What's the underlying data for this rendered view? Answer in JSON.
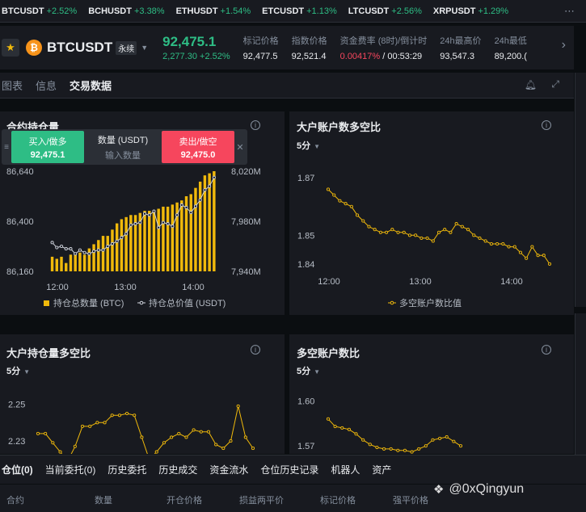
{
  "tickers": [
    {
      "symbol": "BTCUSDT",
      "change": "+2.52%"
    },
    {
      "symbol": "BCHUSDT",
      "change": "+3.38%"
    },
    {
      "symbol": "ETHUSDT",
      "change": "+1.54%"
    },
    {
      "symbol": "ETCUSDT",
      "change": "+1.13%"
    },
    {
      "symbol": "LTCUSDT",
      "change": "+2.56%"
    },
    {
      "symbol": "XRPUSDT",
      "change": "+1.29%"
    }
  ],
  "header": {
    "coin_glyph": "₿",
    "symbol": "BTCUSDT",
    "badge": "永续",
    "price": "92,475.1",
    "change": "2,277.30 +2.52%",
    "stats": [
      {
        "label": "标记价格",
        "value": "92,477.5"
      },
      {
        "label": "指数价格",
        "value": "92,521.4"
      },
      {
        "label": "资金费率 (8时)/倒计时",
        "value_neg": "0.00417%",
        "value": " / 00:53:29"
      },
      {
        "label": "24h最高价",
        "value": "93,547.3"
      },
      {
        "label": "24h最低",
        "value": "89,200.("
      }
    ]
  },
  "tabs": [
    "图表",
    "信息",
    "交易数据"
  ],
  "popup": {
    "buy_label": "买入/做多",
    "buy_price": "92,475.1",
    "qty_label": "数量 (USDT)",
    "qty_placeholder": "输入数量",
    "sell_label": "卖出/做空",
    "sell_price": "92,475.0"
  },
  "panels": {
    "oi": {
      "title": "合约持仓量",
      "y_left_ticks": [
        "86,640",
        "86,400",
        "86,160"
      ],
      "y_right_ticks": [
        "8,020M",
        "7,980M",
        "7,940M"
      ],
      "x_ticks": [
        "12:00",
        "13:00",
        "14:00"
      ],
      "legend_bar": "持仓总数量 (BTC)",
      "legend_line": "持仓总价值 (USDT)"
    },
    "top_accounts": {
      "title": "大户账户数多空比",
      "period": "5分",
      "y_ticks": [
        "1.87",
        "1.85",
        "1.84"
      ],
      "x_ticks": [
        "12:00",
        "13:00",
        "14:00"
      ],
      "legend": "多空账户数比值"
    },
    "top_positions": {
      "title": "大户持仓量多空比",
      "period": "5分",
      "y_ticks": [
        "2.25",
        "2.23"
      ]
    },
    "ls_accounts": {
      "title": "多空账户数比",
      "period": "5分",
      "y_ticks": [
        "1.60",
        "1.57"
      ]
    }
  },
  "bottom_tabs": [
    "仓位(0)",
    "当前委托(0)",
    "历史委托",
    "历史成交",
    "资金流水",
    "仓位历史记录",
    "机器人",
    "资产"
  ],
  "table_headers": [
    "合约",
    "数量",
    "开仓价格",
    "损益两平价",
    "标记价格",
    "强平价格"
  ],
  "watermark": "@0xQingyun",
  "colors": {
    "up": "#2ebd85",
    "down": "#f6465d",
    "accent": "#f0b90b"
  },
  "chart_data": [
    {
      "type": "bar",
      "title": "合约持仓量",
      "xlabel": "",
      "ylabel": "",
      "series": [
        {
          "name": "持仓总数量 (BTC)",
          "type": "bar",
          "axis": "left",
          "values": [
            86230,
            86220,
            86230,
            86200,
            86240,
            86250,
            86250,
            86240,
            86270,
            86290,
            86310,
            86330,
            86330,
            86360,
            86390,
            86410,
            86420,
            86430,
            86430,
            86440,
            86450,
            86450,
            86450,
            86460,
            86470,
            86470,
            86480,
            86490,
            86500,
            86520,
            86530,
            86560,
            86590,
            86620,
            86630,
            86640
          ]
        },
        {
          "name": "持仓总价值 (USDT)",
          "type": "line",
          "axis": "right",
          "values": [
            7963,
            7959,
            7960,
            7958,
            7958,
            7954,
            7957,
            7955,
            7954,
            7956,
            7957,
            7957,
            7960,
            7962,
            7964,
            7967,
            7970,
            7977,
            7978,
            7979,
            7986,
            7985,
            7988,
            7975,
            7979,
            7978,
            7976,
            7985,
            7993,
            7991,
            7987,
            7992,
            7997,
            8005,
            8008,
            8015
          ]
        }
      ],
      "y_left_lim": [
        86160,
        86640
      ],
      "y_right_lim": [
        7940,
        8020
      ]
    },
    {
      "type": "line",
      "title": "大户账户数多空比",
      "series": [
        {
          "name": "多空账户数比值",
          "values": [
            1.866,
            1.864,
            1.862,
            1.861,
            1.86,
            1.857,
            1.855,
            1.853,
            1.852,
            1.851,
            1.851,
            1.852,
            1.851,
            1.851,
            1.85,
            1.85,
            1.849,
            1.849,
            1.848,
            1.851,
            1.852,
            1.851,
            1.854,
            1.853,
            1.852,
            1.85,
            1.849,
            1.848,
            1.847,
            1.847,
            1.847,
            1.846,
            1.846,
            1.844,
            1.842,
            1.846,
            1.843,
            1.843,
            1.84
          ]
        }
      ],
      "ylim": [
        1.838,
        1.874
      ]
    },
    {
      "type": "line",
      "title": "大户持仓量多空比",
      "series": [
        {
          "name": "",
          "values": [
            2.234,
            2.234,
            2.229,
            2.224,
            2.219,
            2.227,
            2.238,
            2.238,
            2.24,
            2.24,
            2.244,
            2.244,
            2.245,
            2.244,
            2.232,
            2.22,
            2.224,
            2.229,
            2.232,
            2.234,
            2.232,
            2.236,
            2.235,
            2.235,
            2.228,
            2.226,
            2.23,
            2.249,
            2.232,
            2.226
          ]
        }
      ],
      "ylim": [
        2.215,
        2.26
      ]
    },
    {
      "type": "line",
      "title": "多空账户数比",
      "series": [
        {
          "name": "",
          "values": [
            1.588,
            1.583,
            1.582,
            1.581,
            1.578,
            1.574,
            1.571,
            1.569,
            1.568,
            1.568,
            1.567,
            1.567,
            1.566,
            1.568,
            1.57,
            1.574,
            1.575,
            1.576,
            1.573,
            1.57
          ]
        }
      ],
      "ylim": [
        1.555,
        1.61
      ]
    }
  ]
}
